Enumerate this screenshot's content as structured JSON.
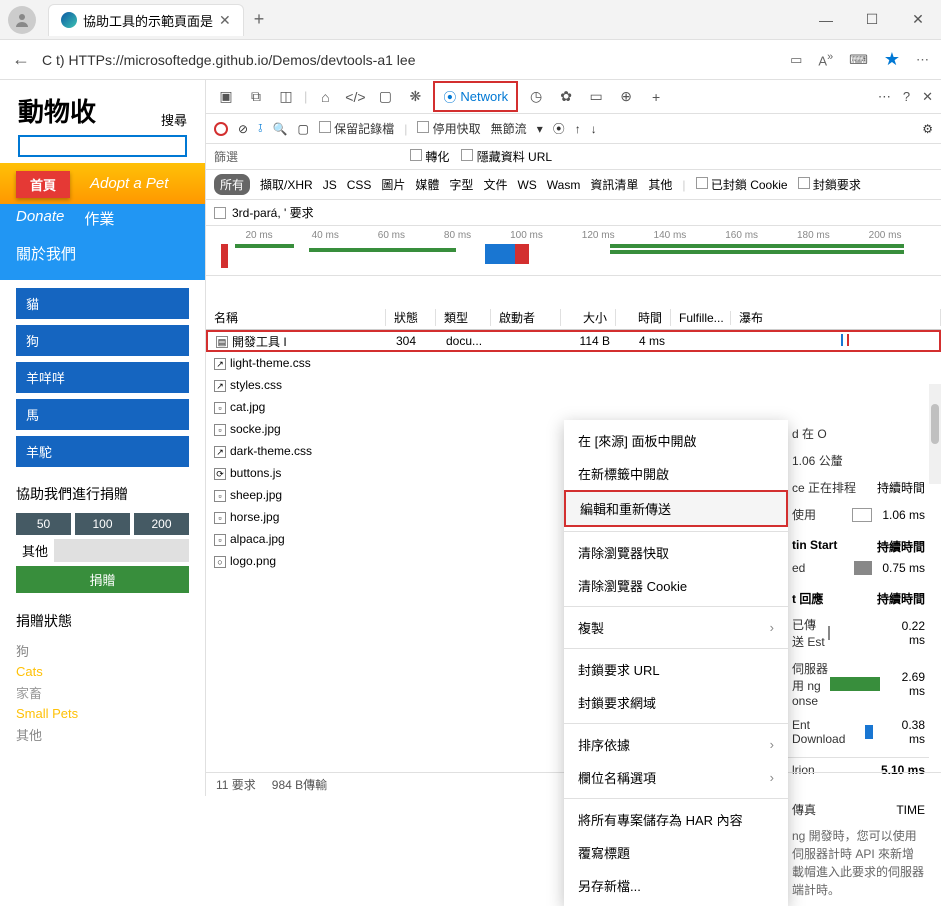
{
  "titlebar": {
    "tab_title": "協助工具的示範頁面是",
    "min": "—",
    "max": "☐",
    "close": "✕"
  },
  "url": "C t) HTTPs://microsoftedge.github.io/Demos/devtools-a1 lee",
  "page": {
    "title": "動物收",
    "search": "搜尋"
  },
  "nav": {
    "home": "首頁",
    "adopt": "Adopt a Pet",
    "donate": "Donate",
    "jobs": "作業",
    "about": "關於我們"
  },
  "animals": [
    "貓",
    "狗",
    "羊咩咩",
    "馬",
    "羊駝"
  ],
  "donate": {
    "title": "協助我們進行捐贈",
    "amounts": [
      "50",
      "100",
      "200"
    ],
    "other": "其他",
    "btn": "捐贈"
  },
  "status": {
    "title": "捐贈狀態",
    "items": [
      "狗",
      "Cats",
      "家畜",
      "Small Pets",
      "其他"
    ]
  },
  "devtools": {
    "network_label": "Network",
    "preserve_log": "保留記錄檔",
    "disable_cache": "停用快取",
    "no_throttle": "無節流",
    "filter": "篩選",
    "invert": "轉化",
    "hide_data": "隱藏資料 URL",
    "types": {
      "all": "所有",
      "fetch": "擷取/XHR",
      "js": "JS",
      "css": "CSS",
      "img": "圖片",
      "media": "媒體",
      "font": "字型",
      "doc": "文件",
      "ws": "WS",
      "wasm": "Wasm",
      "manifest": "資訊清單",
      "other": "其他"
    },
    "blocked_cookies": "已封鎖 Cookie",
    "blocked_requests": "封鎖要求",
    "third_party": "3rd-pará, ' 要求"
  },
  "timeline_ticks": [
    "20 ms",
    "40 ms",
    "60 ms",
    "80 ms",
    "100 ms",
    "120 ms",
    "140 ms",
    "160 ms",
    "180 ms",
    "200 ms"
  ],
  "table": {
    "headers": {
      "name": "名稱",
      "status": "狀態",
      "type": "類型",
      "initiator": "啟動者",
      "size": "大小",
      "time": "時間",
      "fulfilled": "Fulfille...",
      "waterfall": "瀑布"
    },
    "rows": [
      {
        "name": "開發工具 I",
        "status": "304",
        "type": "docu...",
        "size": "114 B",
        "time": "4 ms"
      },
      {
        "name": "light-theme.css"
      },
      {
        "name": "styles.css"
      },
      {
        "name": "cat.jpg"
      },
      {
        "name": "socke.jpg"
      },
      {
        "name": "dark-theme.css"
      },
      {
        "name": "buttons.js"
      },
      {
        "name": "sheep.jpg"
      },
      {
        "name": "horse.jpg"
      },
      {
        "name": "alpaca.jpg"
      },
      {
        "name": "logo.png"
      }
    ]
  },
  "context": {
    "open_sources": "在 [來源] 面板中開啟",
    "open_tab": "在新標籤中開啟",
    "edit_resend": "編輯和重新傳送",
    "clear_cache": "清除瀏覽器快取",
    "clear_cookie": "清除瀏覽器 Cookie",
    "copy": "複製",
    "block_url": "封鎖要求 URL",
    "block_domain": "封鎖要求網域",
    "sort": "排序依據",
    "header_opts": "欄位名稱選項",
    "save_har": "將所有專案儲存為 HAR 內容",
    "override_hdr": "覆寫標題",
    "save_as": "另存新檔..."
  },
  "timing": {
    "queued_at": "d 在 O",
    "distance": "1.06 公釐",
    "queueing_label": "ce 正在排程",
    "queueing_hdr": "持續時間",
    "stalled_label": "使用",
    "stalled_val": "1.06 ms",
    "conn_start": "tin Start",
    "conn_hdr": "持續時間",
    "dns_label": "ed",
    "dns_val": "0.75 ms",
    "req_resp": "t 回應",
    "req_hdr": "持續時間",
    "sent_label": "已傳送 Est",
    "sent_val": "0.22 ms",
    "waiting_label": "伺服器用 ng\nonse",
    "waiting_val": "2.69 ms",
    "download_label": "Ent Download",
    "download_val": "0.38 ms",
    "total_label": "lrion",
    "total_val": "5.10 ms",
    "server_label": "傳真",
    "server_time": "TIME",
    "server_msg": "ng 開發時，您可以使用伺服器計時 API 來新增載帽進入此要求的伺服器端計時。"
  },
  "statusbar": {
    "requests": "11 要求",
    "transferred": "984 B傳輸"
  }
}
